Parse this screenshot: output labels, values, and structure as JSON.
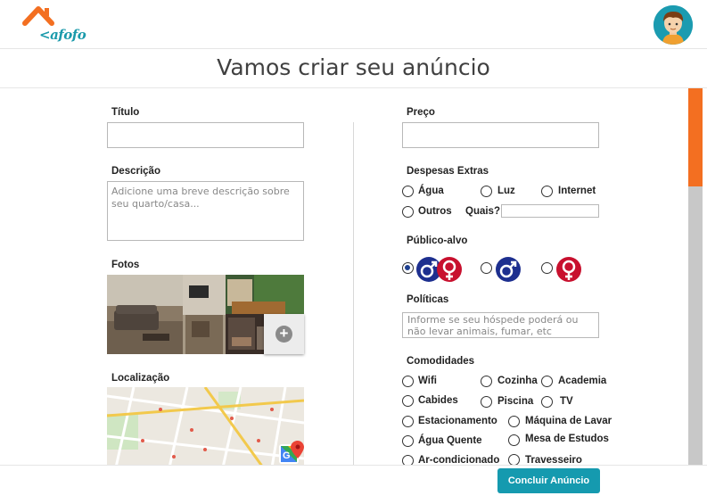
{
  "header": {
    "logo_text": "<afofo",
    "page_title": "Vamos criar seu anúncio"
  },
  "left": {
    "titulo_label": "Título",
    "titulo_value": "",
    "descricao_label": "Descrição",
    "descricao_placeholder": "Adicione uma breve descrição sobre seu quarto/casa...",
    "fotos_label": "Fotos",
    "localizacao_label": "Localização"
  },
  "right": {
    "preco_label": "Preço",
    "preco_value": "",
    "despesas_label": "Despesas Extras",
    "despesas": [
      "Água",
      "Luz",
      "Internet",
      "Outros"
    ],
    "quais_label": "Quais?",
    "publico_label": "Público-alvo",
    "publico_options": [
      "male-female-icon",
      "male-icon",
      "female-icon"
    ],
    "publico_selected": 0,
    "politicas_label": "Políticas",
    "politicas_placeholder": "Informe se seu hóspede poderá ou não levar animais, fumar, etc",
    "comodidades_label": "Comodidades",
    "comodidades": [
      "Wifi",
      "Cozinha",
      "Academia",
      "Cabides",
      "Piscina",
      "TV",
      "Estacionamento",
      "Máquina de Lavar",
      "Água Quente",
      "Mesa de Estudos",
      "Ar-condicionado",
      "Travesseiro"
    ]
  },
  "footer": {
    "submit_label": "Concluir Anúncio"
  },
  "colors": {
    "accent": "#159aaf",
    "orange": "#f36f21",
    "male": "#1d2f8f",
    "female": "#c8102e"
  }
}
